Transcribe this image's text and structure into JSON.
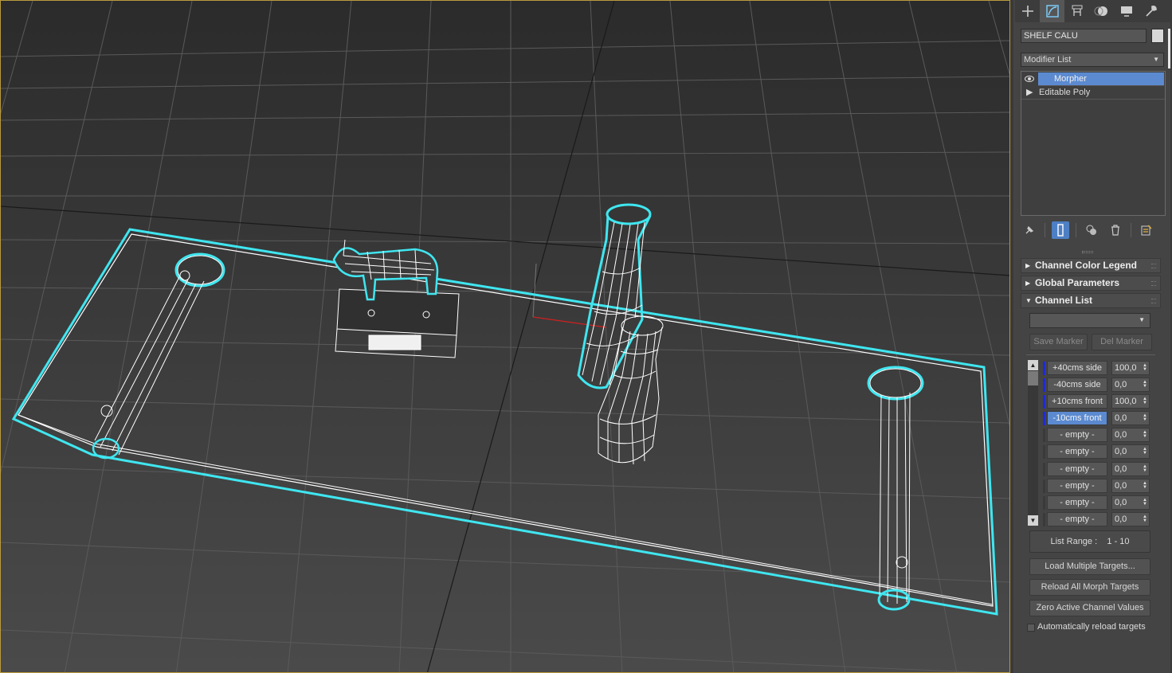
{
  "command_panel": {
    "tabs": [
      {
        "icon": "create-plus-icon"
      },
      {
        "icon": "modify-icon"
      },
      {
        "icon": "hierarchy-icon"
      },
      {
        "icon": "motion-icon"
      },
      {
        "icon": "display-icon"
      },
      {
        "icon": "utilities-wrench-icon"
      }
    ],
    "active_tab_index": 1,
    "object_name": "SHELF CALU",
    "object_color": "#d8d8d8",
    "modifier_list_label": "Modifier List",
    "modifier_stack": [
      {
        "label": "Morpher",
        "selected": true
      },
      {
        "label": "Editable Poly",
        "selected": false
      }
    ]
  },
  "rollouts": {
    "channel_color_legend": "Channel Color Legend",
    "global_parameters": "Global Parameters",
    "channel_list": "Channel List"
  },
  "channel_list": {
    "marker_value": "",
    "save_marker": "Save Marker",
    "del_marker": "Del Marker",
    "channels": [
      {
        "name": "+40cms side",
        "value": "100,0",
        "used": true,
        "active": false
      },
      {
        "name": "-40cms side",
        "value": "0,0",
        "used": true,
        "active": false
      },
      {
        "name": "+10cms front",
        "value": "100,0",
        "used": true,
        "active": false
      },
      {
        "name": "-10cms front",
        "value": "0,0",
        "used": true,
        "active": true
      },
      {
        "name": "- empty -",
        "value": "0,0",
        "used": false,
        "active": false
      },
      {
        "name": "- empty -",
        "value": "0,0",
        "used": false,
        "active": false
      },
      {
        "name": "- empty -",
        "value": "0,0",
        "used": false,
        "active": false
      },
      {
        "name": "- empty -",
        "value": "0,0",
        "used": false,
        "active": false
      },
      {
        "name": "- empty -",
        "value": "0,0",
        "used": false,
        "active": false
      },
      {
        "name": "- empty -",
        "value": "0,0",
        "used": false,
        "active": false
      }
    ],
    "list_range_label": "List Range :",
    "list_range_value": "1 - 10",
    "load_multiple": "Load Multiple Targets...",
    "reload_all": "Reload All Morph Targets",
    "zero_active": "Zero Active Channel Values",
    "auto_reload": "Automatically reload targets",
    "auto_reload_checked": false
  },
  "colors": {
    "selection_cyan": "#3fe6f0",
    "wire_white": "#ffffff",
    "active_blue": "#5b8ad0",
    "channel_used": "#1f2ad8",
    "viewport_border": "#b89a3c"
  }
}
